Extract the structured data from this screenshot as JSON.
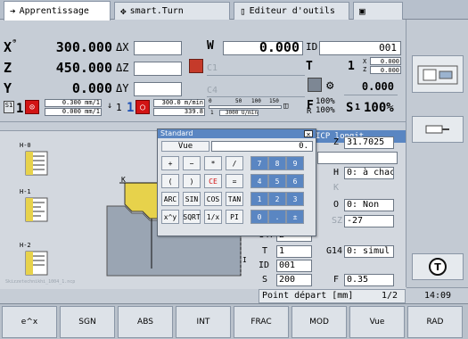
{
  "tabs": [
    {
      "label": "Apprentissage",
      "icon": "arrow-right-icon"
    },
    {
      "label": "smart.Turn",
      "icon": "move-icon"
    },
    {
      "label": "Editeur d'outils",
      "icon": "tool-editor-icon"
    },
    {
      "label": "",
      "icon": "save-icon"
    }
  ],
  "status": {
    "x_label": "X",
    "x_value": "300.000",
    "z_label": "Z",
    "z_value": "450.000",
    "y_label": "Y",
    "y_value": "0.000",
    "delta_x": "ΔX",
    "delta_z": "ΔZ",
    "delta_y": "ΔY",
    "w_label": "W",
    "w_value": "0.000",
    "c1_label": "C1",
    "c4_label": "C4",
    "id_label": "ID",
    "id_value": "001",
    "t_label": "T",
    "t_value": "1",
    "t_x": "0.000",
    "t_z": "0.000",
    "t_x_label": "X",
    "t_z_label": "Z",
    "spindle_value": "0.000",
    "feed_row": {
      "feed1_top": "0.300 mm/1",
      "feed1_bottom": "0.000 mm/1",
      "s1_num": "1",
      "speed_top": "300.0 m/min",
      "speed_bottom": "339.8",
      "s1_label": "S1",
      "g_top_ticks": [
        "50",
        "100",
        "150"
      ],
      "g_bottom": "3000 U/min",
      "f_label": "F",
      "f_pct": "100%",
      "r_pct": "100%",
      "r_label": "R",
      "s_label": "S",
      "s_pct": "100%",
      "zero": "0",
      "one_a": "1",
      "one_b": "1",
      "one_c": "1"
    }
  },
  "calculator": {
    "title": "Standard",
    "mode_label": "Vue",
    "display": "0.",
    "keys": [
      [
        "+",
        "−",
        "*",
        "/",
        "7",
        "8",
        "9"
      ],
      [
        "(",
        ")",
        "CE",
        "=",
        "4",
        "5",
        "6"
      ],
      [
        "ARC",
        "SIN",
        "COS",
        "TAN",
        "1",
        "2",
        "3"
      ],
      [
        "x^y",
        "SQRT",
        "1/x",
        "PI",
        "0",
        ".",
        "±"
      ]
    ]
  },
  "form": {
    "header": "ICP longit.",
    "z_label": "Z",
    "z_value": "31.7025",
    "h_label": "H",
    "h_value": "0: à chac",
    "k_label": "K",
    "o_label": "O",
    "o_value": "0: Non",
    "sz_label": "SZ",
    "sz_value": "-27",
    "g47_label": "G47",
    "g47_value": "2",
    "t_label": "T",
    "t_value": "1",
    "g14_label": "G14",
    "g14_value": "0: simul",
    "id_label": "ID",
    "id_value": "001",
    "s_label": "S",
    "s_value": "200",
    "f_label": "F",
    "f_value": "0.35",
    "help_text": "Point départ [mm]",
    "page": "1/2"
  },
  "graphic": {
    "h0": "H-0",
    "h1": "H-1",
    "h2": "H-2",
    "k_label": "K",
    "i_label": "I",
    "footer": "Skizzetechnikhi_1004_1.ncp"
  },
  "clock": "14:09",
  "softkeys": [
    "e^x",
    "SGN",
    "ABS",
    "INT",
    "FRAC",
    "MOD",
    "Vue",
    "RAD"
  ]
}
